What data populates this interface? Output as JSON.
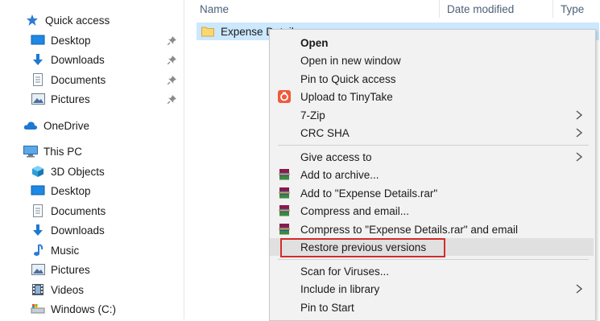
{
  "nav": {
    "quick_access": "Quick access",
    "quick_items": [
      {
        "label": "Desktop",
        "icon": "desktop-icon"
      },
      {
        "label": "Downloads",
        "icon": "download-arrow-icon"
      },
      {
        "label": "Documents",
        "icon": "document-icon"
      },
      {
        "label": "Pictures",
        "icon": "pictures-icon"
      }
    ],
    "onedrive": "OneDrive",
    "this_pc": "This PC",
    "pc_items": [
      {
        "label": "3D Objects",
        "icon": "3d-objects-icon"
      },
      {
        "label": "Desktop",
        "icon": "desktop-icon"
      },
      {
        "label": "Documents",
        "icon": "document-icon"
      },
      {
        "label": "Downloads",
        "icon": "download-arrow-icon"
      },
      {
        "label": "Music",
        "icon": "music-icon"
      },
      {
        "label": "Pictures",
        "icon": "pictures-icon"
      },
      {
        "label": "Videos",
        "icon": "videos-icon"
      },
      {
        "label": "Windows (C:)",
        "icon": "drive-icon"
      }
    ]
  },
  "columns": {
    "name": "Name",
    "date_modified": "Date modified",
    "type": "Type"
  },
  "file": {
    "name": "Expense Details"
  },
  "context_menu": {
    "items": [
      {
        "label": "Open",
        "bold": true
      },
      {
        "label": "Open in new window"
      },
      {
        "label": "Pin to Quick access"
      },
      {
        "label": "Upload to TinyTake",
        "icon": "tinytake-icon"
      },
      {
        "label": "7-Zip",
        "submenu": true
      },
      {
        "label": "CRC SHA",
        "submenu": true
      },
      {
        "label": "Give access to",
        "submenu": true
      },
      {
        "label": "Add to archive...",
        "icon": "winrar-icon"
      },
      {
        "label": "Add to \"Expense Details.rar\"",
        "icon": "winrar-icon"
      },
      {
        "label": "Compress and email...",
        "icon": "winrar-icon"
      },
      {
        "label": "Compress to \"Expense Details.rar\" and email",
        "icon": "winrar-icon"
      },
      {
        "label": "Restore previous versions",
        "highlighted": true
      },
      {
        "label": "Scan for Viruses..."
      },
      {
        "label": "Include in library",
        "submenu": true
      },
      {
        "label": "Pin to Start"
      }
    ]
  },
  "colors": {
    "selection": "#cce8ff",
    "menu_bg": "#f2f2f2",
    "highlight_outline": "#d42a2a",
    "folder": "#f8d775",
    "accent_blue": "#1e88e5"
  }
}
